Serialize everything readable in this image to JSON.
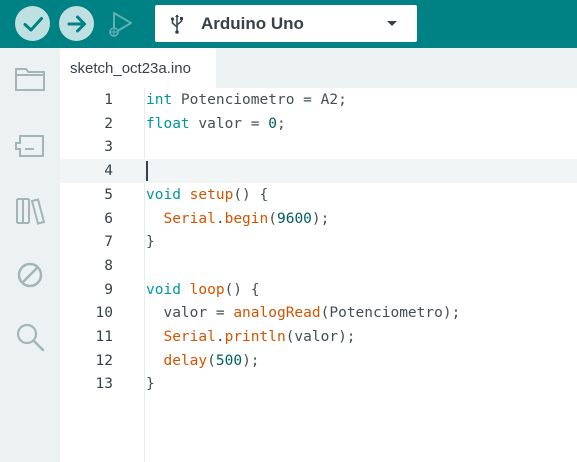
{
  "toolbar": {
    "verify_icon": "check-icon",
    "upload_icon": "arrow-right-icon",
    "debug_icon": "debug-play-icon",
    "board_icon": "usb-icon",
    "board_name": "Arduino Uno",
    "dropdown_icon": "caret-down-icon"
  },
  "sidebar": {
    "items": [
      {
        "icon": "folder-icon"
      },
      {
        "icon": "board-manager-icon"
      },
      {
        "icon": "library-icon"
      },
      {
        "icon": "debug-disabled-icon"
      },
      {
        "icon": "search-icon"
      }
    ]
  },
  "tabs": [
    {
      "label": "sketch_oct23a.ino",
      "active": true
    }
  ],
  "editor": {
    "current_line": 4,
    "lines": [
      {
        "n": "1",
        "tokens": [
          [
            "kw",
            "int"
          ],
          [
            "p",
            " Potenciometro = A2;"
          ]
        ]
      },
      {
        "n": "2",
        "tokens": [
          [
            "kw",
            "float"
          ],
          [
            "p",
            " valor = "
          ],
          [
            "num",
            "0"
          ],
          [
            "p",
            ";"
          ]
        ]
      },
      {
        "n": "3",
        "tokens": []
      },
      {
        "n": "4",
        "tokens": []
      },
      {
        "n": "5",
        "tokens": [
          [
            "kw",
            "void"
          ],
          [
            "p",
            " "
          ],
          [
            "fn",
            "setup"
          ],
          [
            "p",
            "() {"
          ]
        ]
      },
      {
        "n": "6",
        "tokens": [
          [
            "p",
            "  "
          ],
          [
            "fn",
            "Serial"
          ],
          [
            "p",
            "."
          ],
          [
            "fn",
            "begin"
          ],
          [
            "p",
            "("
          ],
          [
            "num",
            "9600"
          ],
          [
            "p",
            ");"
          ]
        ]
      },
      {
        "n": "7",
        "tokens": [
          [
            "p",
            "}"
          ]
        ]
      },
      {
        "n": "8",
        "tokens": []
      },
      {
        "n": "9",
        "tokens": [
          [
            "kw",
            "void"
          ],
          [
            "p",
            " "
          ],
          [
            "fn",
            "loop"
          ],
          [
            "p",
            "() {"
          ]
        ]
      },
      {
        "n": "10",
        "tokens": [
          [
            "p",
            "  valor = "
          ],
          [
            "fn",
            "analogRead"
          ],
          [
            "p",
            "(Potenciometro);"
          ]
        ]
      },
      {
        "n": "11",
        "tokens": [
          [
            "p",
            "  "
          ],
          [
            "fn",
            "Serial"
          ],
          [
            "p",
            "."
          ],
          [
            "fn",
            "println"
          ],
          [
            "p",
            "(valor);"
          ]
        ]
      },
      {
        "n": "12",
        "tokens": [
          [
            "p",
            "  "
          ],
          [
            "fn",
            "delay"
          ],
          [
            "p",
            "("
          ],
          [
            "num",
            "500"
          ],
          [
            "p",
            ");"
          ]
        ]
      },
      {
        "n": "13",
        "tokens": [
          [
            "p",
            "}"
          ]
        ]
      }
    ]
  },
  "colors": {
    "toolbar_bg": "#008184",
    "keyword": "#00979c",
    "function": "#d35400",
    "number": "#005c5f",
    "text": "#434f54"
  }
}
